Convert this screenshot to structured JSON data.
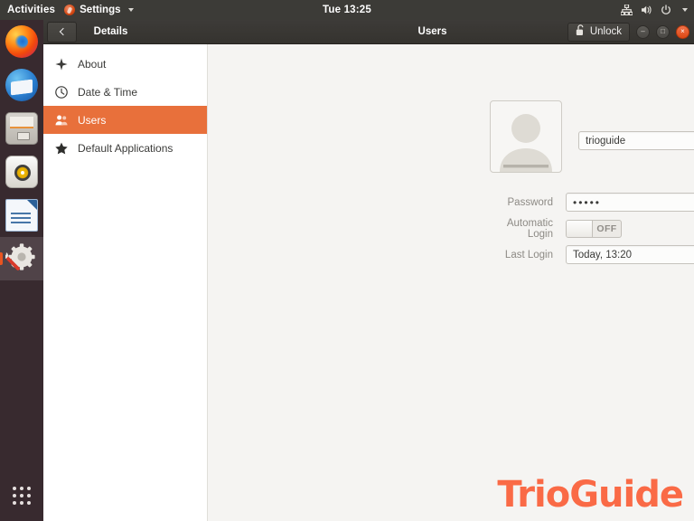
{
  "topbar": {
    "activities": "Activities",
    "app_menu": "Settings",
    "clock": "Tue 13:25",
    "icons": [
      "network-icon",
      "volume-icon",
      "power-icon",
      "chevron-down-icon"
    ]
  },
  "dock": {
    "items": [
      {
        "name": "firefox",
        "label": "Firefox",
        "active": false
      },
      {
        "name": "thunderbird",
        "label": "Thunderbird Mail",
        "active": false
      },
      {
        "name": "files",
        "label": "Files",
        "active": false
      },
      {
        "name": "rhythmbox",
        "label": "Rhythmbox",
        "active": false
      },
      {
        "name": "libreoffice-writer",
        "label": "LibreOffice Writer",
        "active": false
      },
      {
        "name": "settings",
        "label": "Settings",
        "active": true
      }
    ],
    "show_applications": "Show Applications"
  },
  "window": {
    "back_label": "Back",
    "title_left": "Details",
    "title_right": "Users",
    "unlock_label": "Unlock",
    "controls": {
      "minimize": "–",
      "maximize": "□",
      "close": "×"
    }
  },
  "sidebar": {
    "items": [
      {
        "label": "About",
        "icon": "sparkle-icon",
        "selected": false
      },
      {
        "label": "Date & Time",
        "icon": "clock-icon",
        "selected": false
      },
      {
        "label": "Users",
        "icon": "users-icon",
        "selected": true
      },
      {
        "label": "Default Applications",
        "icon": "star-icon",
        "selected": false
      }
    ]
  },
  "user_panel": {
    "avatar_alt": "user-avatar",
    "username": "trioguide",
    "rows": [
      {
        "label": "Password",
        "value": "•••••",
        "type": "password"
      },
      {
        "label": "Automatic Login",
        "value": "OFF",
        "type": "toggle"
      },
      {
        "label": "Last Login",
        "value": "Today, 13:20",
        "type": "text"
      }
    ]
  },
  "watermark": {
    "text": "TrioGuide"
  },
  "colors": {
    "accent_orange": "#e8703b",
    "close_button": "#dd4814",
    "watermark": "#fa6a46",
    "topbar_bg": "#3c3b37",
    "content_bg": "#f5f4f2"
  }
}
